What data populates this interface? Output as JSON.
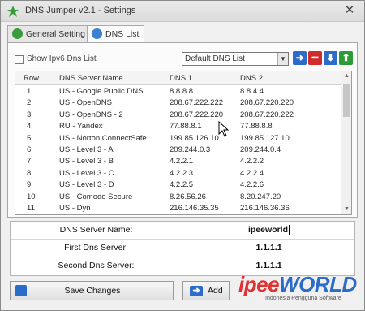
{
  "window": {
    "title": "DNS Jumper v2.1 - Settings",
    "close_glyph": "✕"
  },
  "tabs": [
    {
      "label": "General Setting",
      "icon": "gear-icon",
      "active": false
    },
    {
      "label": "DNS List",
      "icon": "globe-icon",
      "active": true
    }
  ],
  "toolbar": {
    "show_ipv6_label": "Show Ipv6 Dns List",
    "show_ipv6_checked": false,
    "list_select": "Default DNS List",
    "buttons": [
      {
        "name": "move-right-button",
        "icon": "arrow-right-icon",
        "glyph": "➜",
        "color": "#2a6cc8"
      },
      {
        "name": "delete-button",
        "icon": "minus-icon",
        "glyph": "━",
        "color": "#d12c2c"
      },
      {
        "name": "move-down-button",
        "icon": "arrow-down-icon",
        "glyph": "⬇",
        "color": "#2a6cc8"
      },
      {
        "name": "move-up-button",
        "icon": "arrow-up-icon",
        "glyph": "⬆",
        "color": "#2e9a35"
      }
    ]
  },
  "table": {
    "columns": [
      "Row",
      "DNS Server Name",
      "DNS 1",
      "DNS 2"
    ],
    "rows": [
      [
        "1",
        "US - Google Public DNS",
        "8.8.8.8",
        "8.8.4.4"
      ],
      [
        "2",
        "US - OpenDNS",
        "208.67.222.222",
        "208.67.220.220"
      ],
      [
        "3",
        "US - OpenDNS - 2",
        "208.67.222.220",
        "208.67.220.222"
      ],
      [
        "4",
        "RU - Yandex",
        "77.88.8.1",
        "77.88.8.8"
      ],
      [
        "5",
        "US - Norton ConnectSafe ...",
        "199.85.126.10",
        "199.85.127.10"
      ],
      [
        "6",
        "US - Level 3 - A",
        "209.244.0.3",
        "209.244.0.4"
      ],
      [
        "7",
        "US - Level 3 - B",
        "4.2.2.1",
        "4.2.2.2"
      ],
      [
        "8",
        "US - Level 3 - C",
        "4.2.2.3",
        "4.2.2.4"
      ],
      [
        "9",
        "US - Level 3 - D",
        "4.2.2.5",
        "4.2.2.6"
      ],
      [
        "10",
        "US - Comodo Secure",
        "8.26.56.26",
        "8.20.247.20"
      ],
      [
        "11",
        "US - Dyn",
        "216.146.35.35",
        "216.146.36.36"
      ]
    ]
  },
  "form": {
    "name_label": "DNS Server Name:",
    "name_value": "ipeeworld",
    "first_label": "First Dns Server:",
    "first_value": "1.1.1.1",
    "second_label": "Second Dns Server:",
    "second_value": "1.1.1.1"
  },
  "buttons": {
    "save_label": "Save Changes",
    "add_label": "Add",
    "add_glyph": "➜"
  },
  "watermark": {
    "part1": "ipee",
    "part2": "WORLD",
    "tagline": "Indonesia Pengguna Software"
  }
}
